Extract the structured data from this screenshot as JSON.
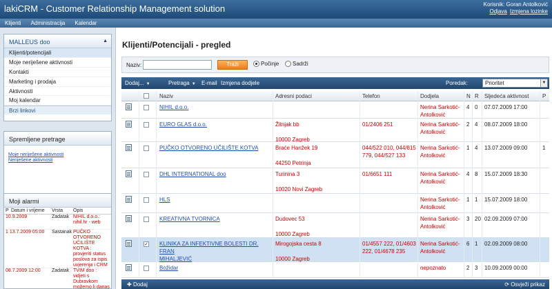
{
  "header": {
    "title": "lakiCRM - Customer Relationship Management solution",
    "user_label": "Korisnik: Goran Antolković",
    "logout": "Odjava",
    "change_pw": "Izmjena lozinke"
  },
  "nav": {
    "items": [
      "Klijenti",
      "Administracija",
      "Kalendar"
    ]
  },
  "sidebar": {
    "org": "MALLEUS doo",
    "items": [
      "Klijenti/potencijali",
      "Moje neriješene aktivnosti",
      "Kontakti",
      "Marketing i prodaja",
      "Aktivnosti",
      "Moj kalendar"
    ],
    "quick_links": "Brzi linkovi"
  },
  "saved": {
    "title": "Spremljene pretrage",
    "links": [
      "Moje neriješene aktivnosti",
      "Neriješene aktivnosti"
    ]
  },
  "alarms": {
    "title": "Moji alarmi",
    "headers": {
      "p": "P",
      "date": "Datum i vrijeme",
      "type": "Vrsta",
      "desc": "Opis"
    },
    "rows": [
      {
        "date": "10.9.2009",
        "type": "Zadatak",
        "desc": "NIHIL d.o.o.: nihil.hr - web"
      },
      {
        "date": "1 13.7.2009 05:00",
        "type": "Sastanak",
        "desc": "PUČKO OTVORENO UČILIŠTE KOTVA : provjeriti status poslova za ispis uvjerenja i CRM"
      },
      {
        "date": "08.7.2009 12:00",
        "type": "Zadatak",
        "desc": "TVIM doo : vidjeti s Dubravkom možemo li danas uspostaviti"
      }
    ]
  },
  "main": {
    "title": "Klijenti/Potencijali - pregled",
    "search": {
      "label": "Naziv:",
      "value": "",
      "button": "Traži",
      "opt_starts": "Počinje",
      "opt_contains": "Sadrži"
    },
    "toolbar": {
      "add": "Dodaj...",
      "search": "Pretraga",
      "email": "E-mail",
      "change": "Izmjena dodjele",
      "sort_label": "Poredak:",
      "sort_value": "Prioritet"
    },
    "columns": {
      "name": "Naziv",
      "address": "Adresni podaci",
      "phone": "Telefon",
      "assign": "Dodjela",
      "n": "N",
      "r": "R",
      "next": "Sljedeća aktivnost",
      "p": "P"
    },
    "rows": [
      {
        "name": "NIHIL d.o.o.",
        "address": "",
        "phone": "",
        "assign": "Nerina Sarkotić-\nAntolković",
        "n": "4",
        "r": "0",
        "next": "07.07.2009 17:00",
        "p": "",
        "checked": ""
      },
      {
        "name": "EURO GLAS d.o.o.",
        "address": "Žitnjak bb\n\n10000 Zagreb",
        "phone": "01/2406 251",
        "assign": "Nerina Sarkotić-\nAntolković",
        "n": "2",
        "r": "4",
        "next": "08.07.2009 18:00",
        "p": "",
        "checked": ""
      },
      {
        "name": "PUČKO OTVORENO UČILIŠTE KOTVA",
        "address": "Braće Hanžek 19\n\n44250 Petrinja",
        "phone": "044/522 010, 044/815\n779, 044/527 133",
        "assign": "Nerina Sarkotić-\nAntolković",
        "n": "1",
        "r": "4",
        "next": "13.07.2009 09:00",
        "p": "1",
        "checked": ""
      },
      {
        "name": "DHL INTERNATIONAL doo",
        "address": "Turinina 3\n\n10020 Novi Zagreb",
        "phone": "01/6651 111",
        "assign": "Nerina Sarkotić-\nAntolković",
        "n": "4",
        "r": "8",
        "next": "15.07.2009 18:30",
        "p": "",
        "checked": ""
      },
      {
        "name": "HLS",
        "address": "",
        "phone": "",
        "assign": "Nerina Sarkotić-\nAntolković",
        "n": "1",
        "r": "1",
        "next": "15.07.2009 18:00",
        "p": "",
        "checked": ""
      },
      {
        "name": "KREATIVNA TVORNICA",
        "address": "Dudovec 53\n\n10000 Zagreb",
        "phone": "",
        "assign": "Nerina Sarkotić-\nAntolković",
        "n": "3",
        "r": "20",
        "next": "02.09.2009 07:00",
        "p": "",
        "checked": ""
      },
      {
        "name": "KLINIKA ZA INFEKTIVNE BOLESTI DR. FRAN\nMIHALJEVIĆ",
        "address": "Mirogojska cesta 8\n\n10000 Zagreb",
        "phone": "01/4557 222, 01/4603\n222, 01/4678 235",
        "assign": "Nerina Sarkotić-\nAntolković",
        "n": "6",
        "r": "1",
        "next": "02.09.2009 08:00",
        "p": "",
        "checked": "✓"
      },
      {
        "name": "Božidar",
        "address": "",
        "phone": "",
        "assign": "nepoznato",
        "n": "2",
        "r": "3",
        "next": "10.09.2009 00:00",
        "p": "",
        "checked": ""
      }
    ],
    "footer": {
      "add": "Dodaj",
      "refresh": "Osvježi prikaz"
    }
  }
}
